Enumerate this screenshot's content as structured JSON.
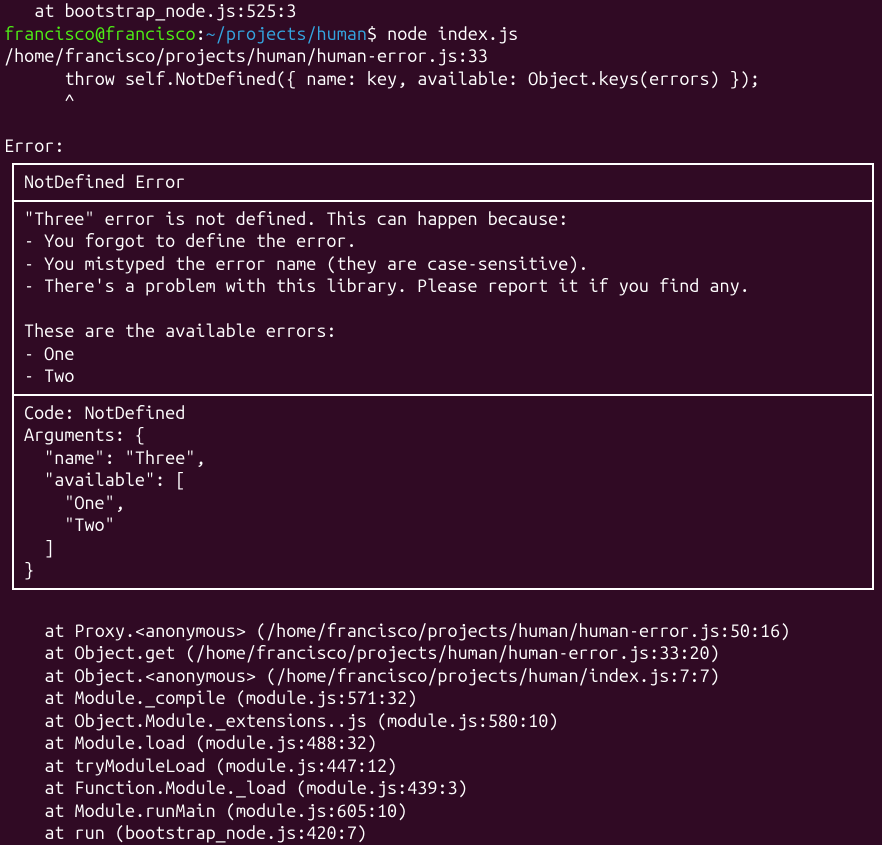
{
  "prompt": {
    "topCutoff": "   at bootstrap_node.js:525:3",
    "user": "francisco",
    "host": "francisco",
    "separator": "@",
    "colon": ":",
    "path": "~/projects/human",
    "dollar": "$",
    "command": "node index.js"
  },
  "preError": {
    "fileLine": "/home/francisco/projects/human/human-error.js:33",
    "throwLine": "      throw self.NotDefined({ name: key, available: Object.keys(errors) });",
    "caret": "      ^"
  },
  "errorLabel": "Error:",
  "errorBox": {
    "title": "NotDefined Error",
    "body": "\"Three\" error is not defined. This can happen because:\n- You forgot to define the error.\n- You mistyped the error name (they are case-sensitive).\n- There's a problem with this library. Please report it if you find any.\n\nThese are the available errors:\n- One\n- Two",
    "code": "Code: NotDefined\nArguments: {\n  \"name\": \"Three\",\n  \"available\": [\n    \"One\",\n    \"Two\"\n  ]\n}"
  },
  "stack": [
    "    at Proxy.<anonymous> (/home/francisco/projects/human/human-error.js:50:16)",
    "    at Object.get (/home/francisco/projects/human/human-error.js:33:20)",
    "    at Object.<anonymous> (/home/francisco/projects/human/index.js:7:7)",
    "    at Module._compile (module.js:571:32)",
    "    at Object.Module._extensions..js (module.js:580:10)",
    "    at Module.load (module.js:488:32)",
    "    at tryModuleLoad (module.js:447:12)",
    "    at Function.Module._load (module.js:439:3)",
    "    at Module.runMain (module.js:605:10)",
    "    at run (bootstrap_node.js:420:7)"
  ]
}
